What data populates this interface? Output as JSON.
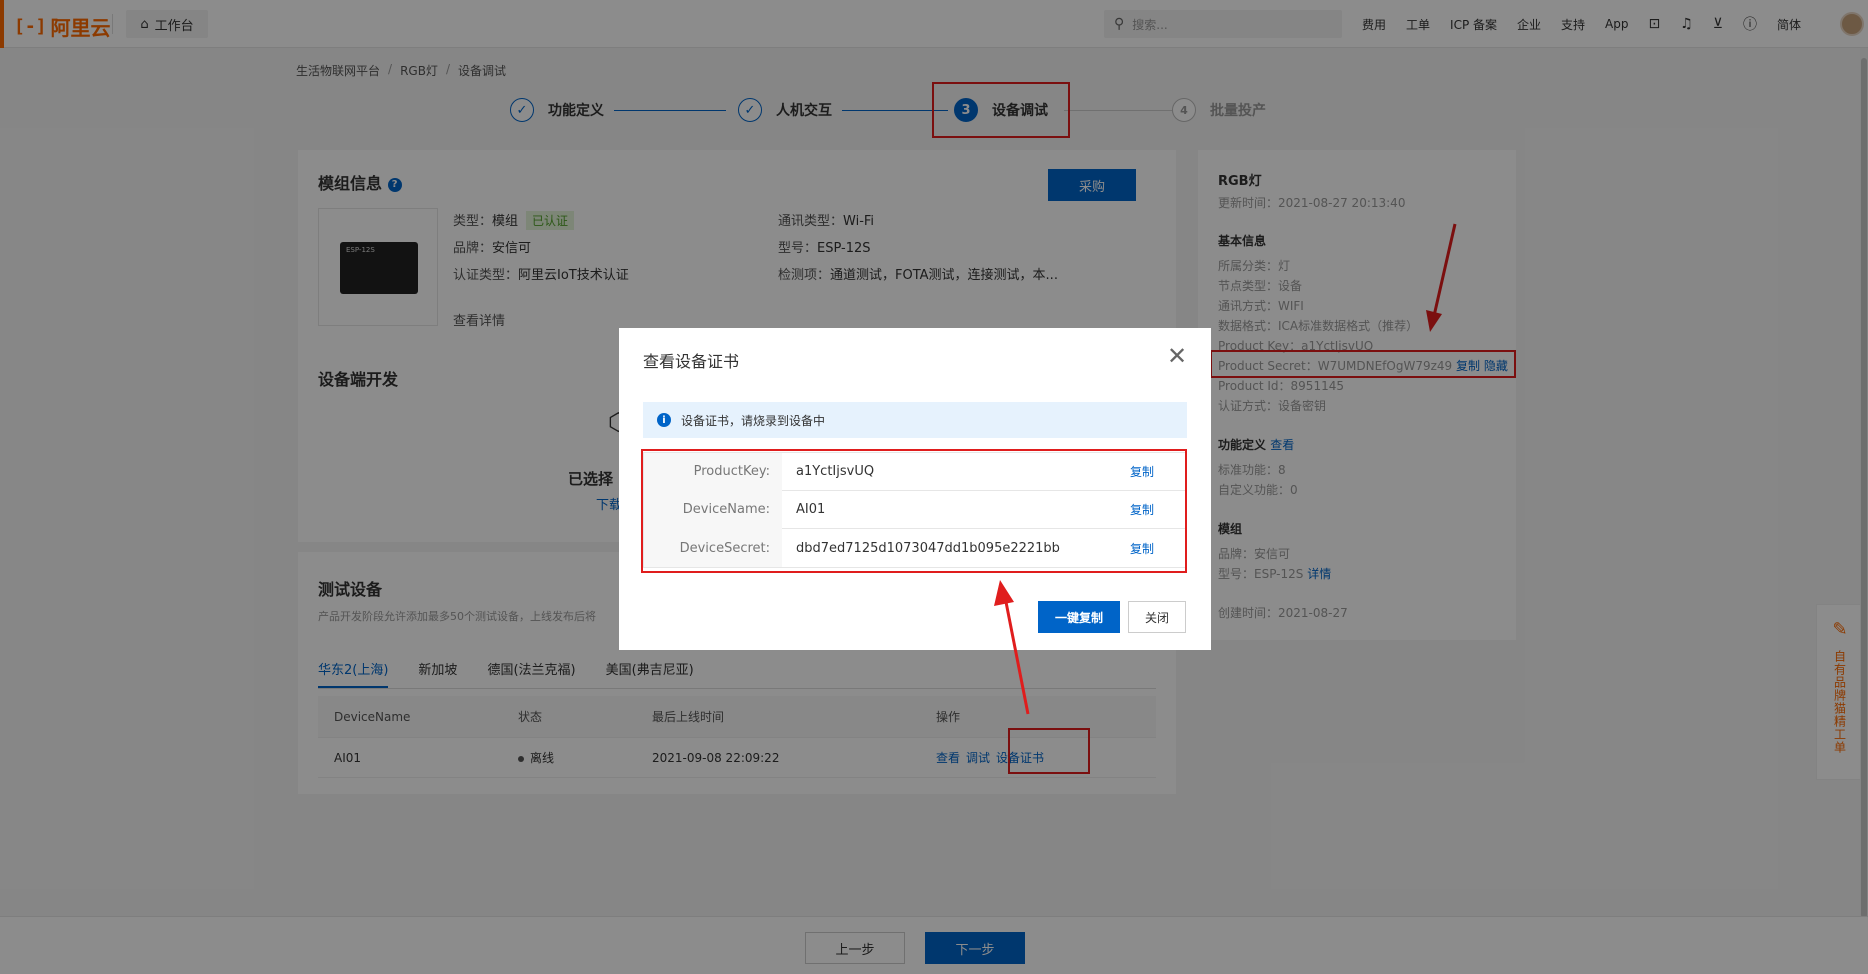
{
  "topbar": {
    "logo_mark": "[-]",
    "logo_text": "阿里云",
    "workbench": "工作台",
    "search_placeholder": "搜索...",
    "nav": [
      "费用",
      "工单",
      "ICP 备案",
      "企业",
      "支持",
      "App"
    ],
    "lang": "简体"
  },
  "breadcrumb": [
    "生活物联网平台",
    "RGB灯",
    "设备调试"
  ],
  "steps": [
    {
      "num": "✓",
      "label": "功能定义",
      "state": "done"
    },
    {
      "num": "✓",
      "label": "人机交互",
      "state": "done"
    },
    {
      "num": "3",
      "label": "设备调试",
      "state": "active"
    },
    {
      "num": "4",
      "label": "批量投产",
      "state": "todo"
    }
  ],
  "module": {
    "title": "模组信息",
    "buy": "采购",
    "chip_label": "ESP-12S",
    "type_label": "类型：",
    "type_value": "模组",
    "certified_tag": "已认证",
    "brand_label": "品牌：",
    "brand_value": "安信可",
    "cert_label": "认证类型：",
    "cert_value": "阿里云IoT技术认证",
    "comm_label": "通讯类型：",
    "comm_value": "Wi-Fi",
    "model_label": "型号：",
    "model_value": "ESP-12S",
    "check_label": "检测项：",
    "check_value": "通道测试，FOTA测试，连接测试，本...",
    "detail_link": "查看详情"
  },
  "devdev": {
    "title": "设备端开发",
    "selected_text": "已选择",
    "download_text": "下载"
  },
  "testdev": {
    "title": "测试设备",
    "desc": "产品开发阶段允许添加最多50个测试设备，上线发布后将",
    "tabs": [
      "华东2(上海)",
      "新加坡",
      "德国(法兰克福)",
      "美国(弗吉尼亚)"
    ],
    "columns": [
      "DeviceName",
      "状态",
      "最后上线时间",
      "操作"
    ],
    "rows": [
      {
        "name": "AI01",
        "status": "离线",
        "last_online": "2021-09-08 22:09:22",
        "actions": [
          "查看",
          "调试",
          "设备证书"
        ]
      }
    ]
  },
  "right": {
    "product": "RGB灯",
    "updated": "更新时间：2021-08-27 20:13:40",
    "basic_title": "基本信息",
    "basic": [
      "所属分类：灯",
      "节点类型：设备",
      "通讯方式：WIFI",
      "数据格式：ICA标准数据格式（推荐）",
      "Product Key：a1YctIjsvUQ",
      "Product Secret：W7UMDNEfOgW79z49",
      "Product Id：8951145",
      "认证方式：设备密钥"
    ],
    "secret_copy": "复制",
    "secret_hide": "隐藏",
    "func_title": "功能定义",
    "func_link": "查看",
    "func_items": [
      "标准功能：8",
      "自定义功能：0"
    ],
    "mod_title": "模组",
    "mod_items": [
      "品牌：安信可",
      "型号：ESP-12S"
    ],
    "mod_detail": "详情",
    "created": "创建时间：2021-08-27"
  },
  "modal": {
    "title": "查看设备证书",
    "notice": "设备证书，请烧录到设备中",
    "rows": [
      {
        "key": "ProductKey:",
        "value": "a1YctIjsvUQ",
        "copy": "复制"
      },
      {
        "key": "DeviceName:",
        "value": "AI01",
        "copy": "复制"
      },
      {
        "key": "DeviceSecret:",
        "value": "dbd7ed7125d1073047dd1b095e2221bb",
        "copy": "复制"
      }
    ],
    "copy_all": "一键复制",
    "close": "关闭"
  },
  "footer": {
    "prev": "上一步",
    "next": "下一步"
  },
  "sidewidget": {
    "text": "自有品牌猫精工单"
  },
  "colors": {
    "accent": "#ff6a00",
    "primary": "#0064c8",
    "highlight": "#e01d1d"
  }
}
